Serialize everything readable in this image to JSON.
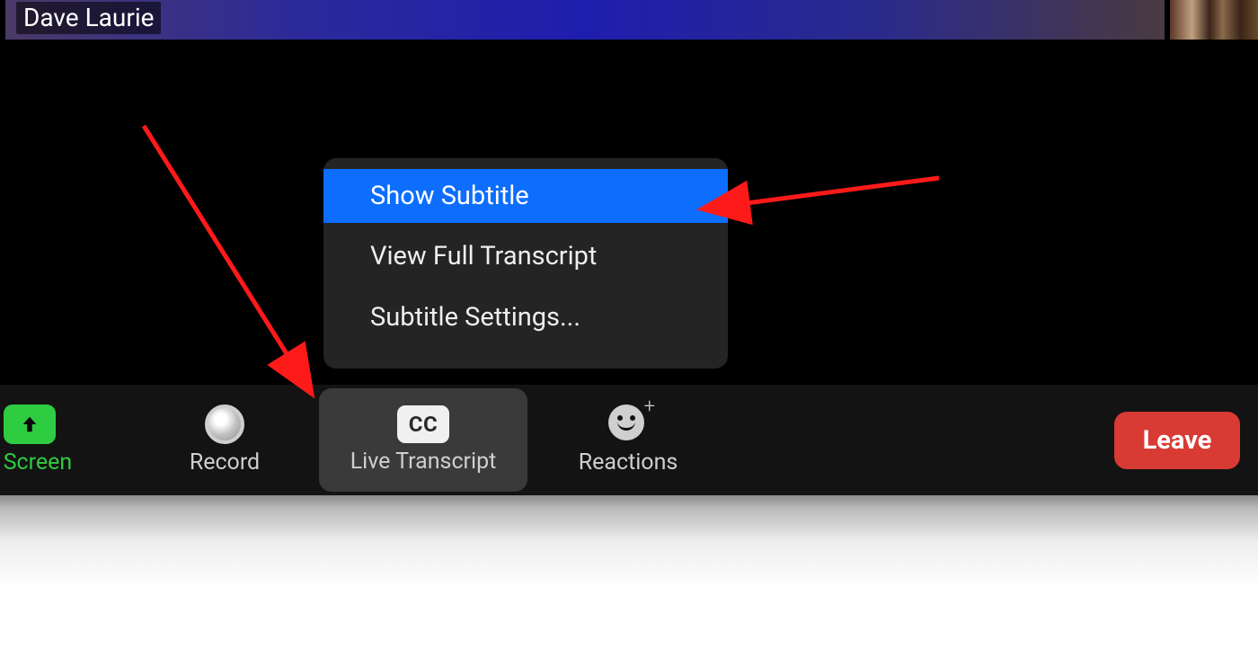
{
  "participant": {
    "name": "Dave Laurie"
  },
  "popup": {
    "items": [
      {
        "label": "Show Subtitle",
        "highlighted": true
      },
      {
        "label": "View Full Transcript",
        "highlighted": false
      },
      {
        "label": "Subtitle Settings...",
        "highlighted": false
      }
    ]
  },
  "toolbar": {
    "share_label": "re Screen",
    "record_label": "Record",
    "cc_badge": "CC",
    "live_transcript_label": "Live Transcript",
    "reactions_label": "Reactions",
    "leave_label": "Leave"
  }
}
